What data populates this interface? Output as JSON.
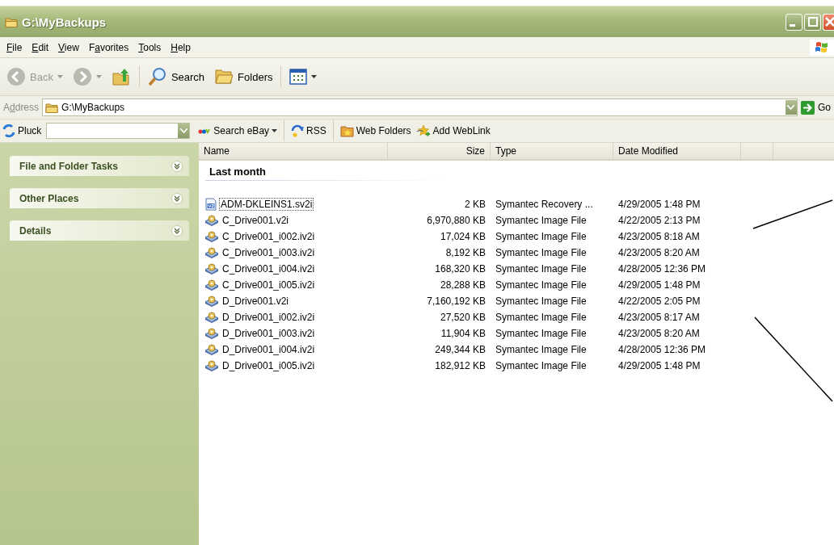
{
  "window": {
    "title": "G:\\MyBackups"
  },
  "menu": [
    {
      "key": "F",
      "post": "ile"
    },
    {
      "key": "E",
      "post": "dit"
    },
    {
      "key": "V",
      "post": "iew"
    },
    {
      "pre": "F",
      "key": "a",
      "post": "vorites"
    },
    {
      "key": "T",
      "post": "ools"
    },
    {
      "key": "H",
      "post": "elp"
    }
  ],
  "toolbar": [
    {
      "kind": "back",
      "label": "Back",
      "disabled": true
    },
    {
      "kind": "forward",
      "disabled": true
    },
    {
      "kind": "up"
    },
    {
      "kind": "search",
      "label": "Search"
    },
    {
      "kind": "folders",
      "label": "Folders"
    },
    {
      "kind": "views"
    }
  ],
  "address": {
    "label": {
      "pre": "A",
      "key": "d",
      "post": "dress"
    },
    "value": "G:\\MyBackups",
    "go": "Go"
  },
  "links": [
    {
      "kind": "pluck",
      "label": "Pluck"
    },
    {
      "kind": "field"
    },
    {
      "kind": "ebay",
      "label": "Search eBay"
    },
    {
      "kind": "rss",
      "label": "RSS"
    },
    {
      "kind": "webfolders",
      "label": "Web Folders"
    },
    {
      "kind": "weblink",
      "label": "Add WebLink"
    }
  ],
  "sidebar": {
    "panels": [
      {
        "title": "File and Folder Tasks",
        "expanded": false
      },
      {
        "title": "Other Places",
        "expanded": false
      },
      {
        "title": "Details",
        "expanded": false
      }
    ]
  },
  "table": {
    "columns": [
      "Name",
      "Size",
      "Type",
      "Date Modified"
    ],
    "group": "Last month",
    "rows": [
      {
        "kind": "recovery",
        "name": "ADM-DKLEINS1.sv2i",
        "size": "2 KB",
        "type": "Symantec Recovery ...",
        "date": "4/29/2005 1:48 PM",
        "focused": true
      },
      {
        "kind": "image",
        "name": "C_Drive001.v2i",
        "size": "6,970,880 KB",
        "type": "Symantec Image File",
        "date": "4/22/2005 2:13 PM",
        "focused": false
      },
      {
        "kind": "image",
        "name": "C_Drive001_i002.iv2i",
        "size": "17,024 KB",
        "type": "Symantec Image File",
        "date": "4/23/2005 8:18 AM",
        "focused": false
      },
      {
        "kind": "image",
        "name": "C_Drive001_i003.iv2i",
        "size": "8,192 KB",
        "type": "Symantec Image File",
        "date": "4/23/2005 8:20 AM",
        "focused": false
      },
      {
        "kind": "image",
        "name": "C_Drive001_i004.iv2i",
        "size": "168,320 KB",
        "type": "Symantec Image File",
        "date": "4/28/2005 12:36 PM",
        "focused": false
      },
      {
        "kind": "image",
        "name": "C_Drive001_i005.iv2i",
        "size": "28,288 KB",
        "type": "Symantec Image File",
        "date": "4/29/2005 1:48 PM",
        "focused": false
      },
      {
        "kind": "image",
        "name": "D_Drive001.v2i",
        "size": "7,160,192 KB",
        "type": "Symantec Image File",
        "date": "4/22/2005 2:05 PM",
        "focused": false
      },
      {
        "kind": "image",
        "name": "D_Drive001_i002.iv2i",
        "size": "27,520 KB",
        "type": "Symantec Image File",
        "date": "4/23/2005 8:17 AM",
        "focused": false
      },
      {
        "kind": "image",
        "name": "D_Drive001_i003.iv2i",
        "size": "11,904 KB",
        "type": "Symantec Image File",
        "date": "4/23/2005 8:20 AM",
        "focused": false
      },
      {
        "kind": "image",
        "name": "D_Drive001_i004.iv2i",
        "size": "249,344 KB",
        "type": "Symantec Image File",
        "date": "4/28/2005 12:36 PM",
        "focused": false
      },
      {
        "kind": "image",
        "name": "D_Drive001_i005.iv2i",
        "size": "182,912 KB",
        "type": "Symantec Image File",
        "date": "4/29/2005 1:48 PM",
        "focused": false
      }
    ]
  }
}
